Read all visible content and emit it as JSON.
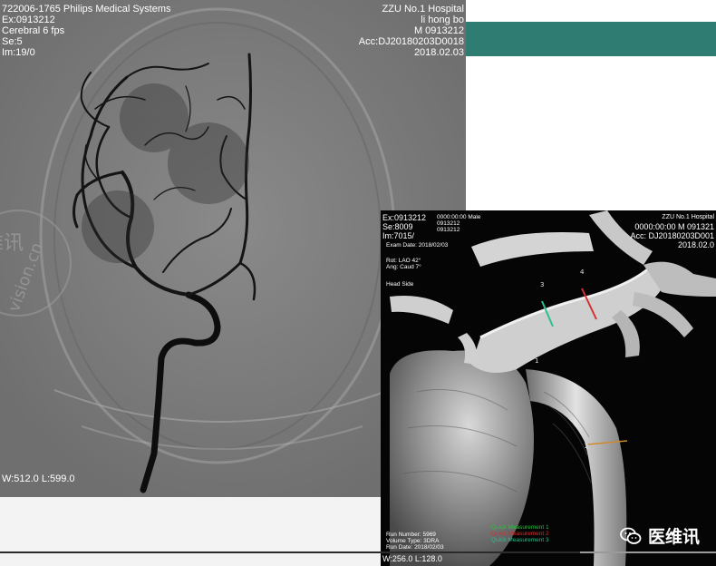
{
  "left_view": {
    "top_left": [
      "722006-1765 Philips Medical Systems",
      "Ex:0913212",
      "Cerebral 6 fps",
      "Se:5",
      "Im:19/0"
    ],
    "top_right": [
      "ZZU No.1 Hospital",
      "li hong bo",
      "M 0913212",
      "Acc:DJ20180203D0018",
      "2018.02.03"
    ],
    "window_level": "W:512.0 L:599.0",
    "watermark_url_fragment": "vision.cn",
    "watermark_cn": "维讯"
  },
  "right_view": {
    "top_left": [
      "Ex:0913212",
      "Se:8009",
      "Im:7015/"
    ],
    "top_left_small": [
      "0000:00:00 Male",
      "0913212",
      "0913212"
    ],
    "exam_date": "Exam Date:  2018/02/03",
    "rotation": [
      "Rot:   LAO 42°",
      "Ang:   Caud  7°"
    ],
    "head_side": "Head Side",
    "top_right": [
      "ZZU No.1 Hospital",
      "0000:00:00 M 091321",
      "Acc: DJ20180203D001",
      "2018.02.0"
    ],
    "bottom_left": [
      "Run Number:  5969",
      "Volume Type:  3DRA",
      "Run Date:  2018/02/03"
    ],
    "window_level": "W:256.0 L:128.0",
    "measurements": [
      {
        "label": "Quick Measurement 1",
        "color": "#27c23a"
      },
      {
        "label": "Quick Measurement 2",
        "color": "#d63030"
      },
      {
        "label": "Quick Measurement 3",
        "color": "#2bbf8f"
      }
    ],
    "marker_labels": [
      "1",
      "2",
      "3",
      "4"
    ]
  },
  "badge": {
    "text": "医维讯",
    "icon": "wechat-icon"
  },
  "colors": {
    "teal": "#2f7d72",
    "vessel_dark": "#111111",
    "measure_red": "#d63030",
    "measure_green": "#2bbf8f",
    "measure_orange": "#d08a2a"
  }
}
